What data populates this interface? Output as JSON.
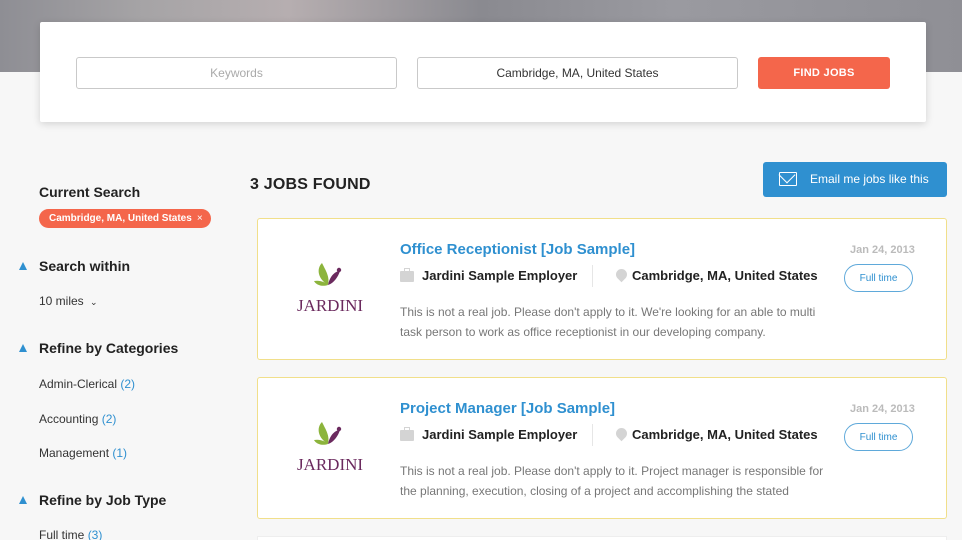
{
  "search": {
    "keywords_placeholder": "Keywords",
    "location_value": "Cambridge, MA, United States",
    "find_label": "FIND JOBS"
  },
  "sidebar": {
    "current_search_title": "Current Search",
    "current_search_chip": "Cambridge, MA, United States",
    "chip_remove": "×",
    "search_within_title": "Search within",
    "search_within_value": "10 miles",
    "categories_title": "Refine by Categories",
    "categories": [
      {
        "label": "Admin-Clerical",
        "count": "(2)"
      },
      {
        "label": "Accounting",
        "count": "(2)"
      },
      {
        "label": "Management",
        "count": "(1)"
      }
    ],
    "job_type_title": "Refine by Job Type",
    "job_types": [
      {
        "label": "Full time",
        "count": "(3)"
      }
    ]
  },
  "results": {
    "title": "3 JOBS FOUND",
    "email_label": "Email me jobs like this"
  },
  "jobs": [
    {
      "title": "Office Receptionist [Job Sample]",
      "employer": "Jardini Sample Employer",
      "location": "Cambridge, MA, United States",
      "description": "This is not a real job. Please don't apply to it. We're looking for an able to multi task person to work as office receptionist in our developing company.",
      "date": "Jan 24, 2013",
      "type": "Full time",
      "logo_text": "JARDINI"
    },
    {
      "title": "Project Manager [Job Sample]",
      "employer": "Jardini Sample Employer",
      "location": "Cambridge, MA, United States",
      "description": "This is not a real job. Please don't apply to it. Project manager is responsible for the planning, execution, closing of a project and accomplishing the stated",
      "date": "Jan 24, 2013",
      "type": "Full time",
      "logo_text": "JARDINI"
    }
  ],
  "colors": {
    "accent_orange": "#f4664b",
    "accent_blue": "#2f90d0",
    "card_border": "#f1df8a",
    "logo_purple": "#6b2a5e",
    "logo_green": "#8cb43c"
  }
}
